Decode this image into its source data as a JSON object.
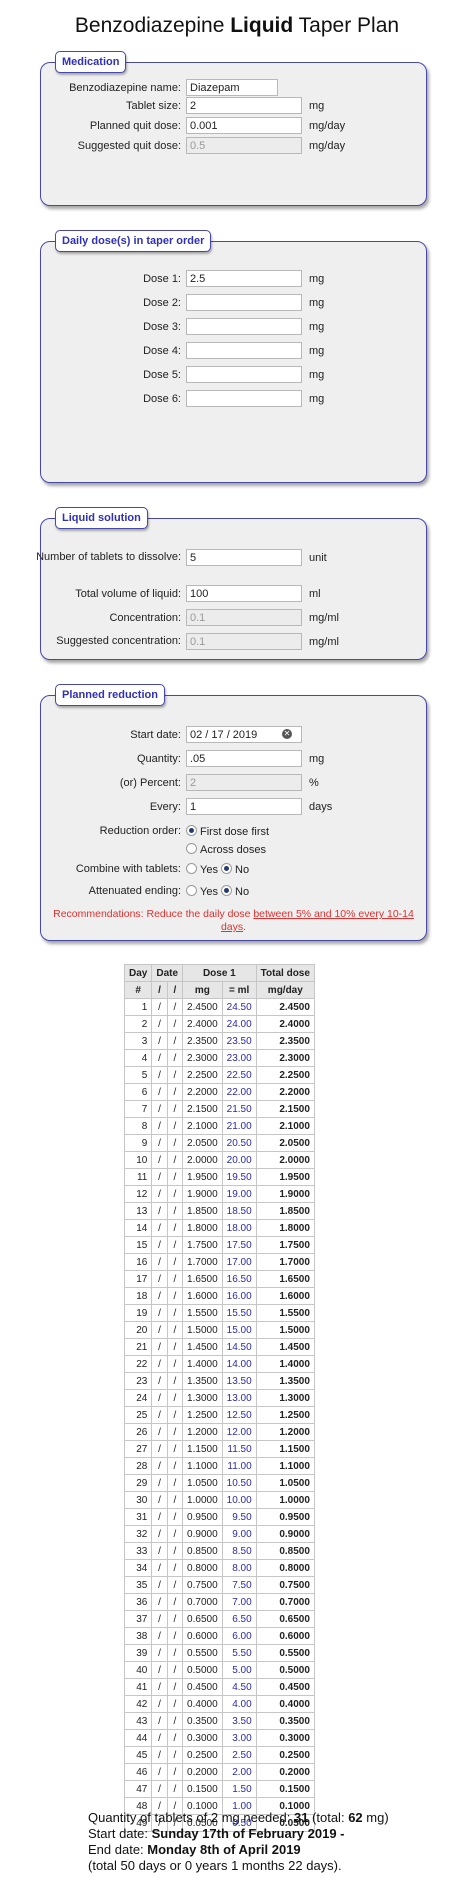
{
  "title": {
    "pre": "Benzodiazepine ",
    "bold": "Liquid",
    "post": " Taper Plan"
  },
  "medication": {
    "legend": "Medication",
    "name_label": "Benzodiazepine name:",
    "name_value": "Diazepam",
    "tablet_label": "Tablet size:",
    "tablet_value": "2",
    "tablet_unit": "mg",
    "quit_label": "Planned quit dose:",
    "quit_value": "0.001",
    "quit_unit": "mg/day",
    "suggested_label": "Suggested quit dose:",
    "suggested_value": "0.5",
    "suggested_unit": "mg/day"
  },
  "daily": {
    "legend": "Daily dose(s) in taper order",
    "doses": [
      {
        "label": "Dose 1:",
        "value": "2.5",
        "unit": "mg"
      },
      {
        "label": "Dose 2:",
        "value": "",
        "unit": "mg"
      },
      {
        "label": "Dose 3:",
        "value": "",
        "unit": "mg"
      },
      {
        "label": "Dose 4:",
        "value": "",
        "unit": "mg"
      },
      {
        "label": "Dose 5:",
        "value": "",
        "unit": "mg"
      },
      {
        "label": "Dose 6:",
        "value": "",
        "unit": "mg"
      }
    ]
  },
  "liquid": {
    "legend": "Liquid solution",
    "tablets_label": "Number of tablets to dissolve:",
    "tablets_value": "5",
    "tablets_unit": "unit",
    "volume_label": "Total volume of liquid:",
    "volume_value": "100",
    "volume_unit": "ml",
    "conc_label": "Concentration:",
    "conc_value": "0.1",
    "conc_unit": "mg/ml",
    "sugg_label": "Suggested concentration:",
    "sugg_value": "0.1",
    "sugg_unit": "mg/ml"
  },
  "reduction": {
    "legend": "Planned reduction",
    "start_label": "Start date:",
    "start_value": "02 / 17 / 2019",
    "clear_glyph": "✕",
    "qty_label": "Quantity:",
    "qty_value": ".05",
    "qty_unit": "mg",
    "pct_label": "(or) Percent:",
    "pct_value": "2",
    "pct_unit": "%",
    "every_label": "Every:",
    "every_value": "1",
    "every_unit": "days",
    "order_label": "Reduction order:",
    "order_opt1": "First dose first",
    "order_opt2": "Across doses",
    "combine_label": "Combine with tablets:",
    "yes": "Yes",
    "no": "No",
    "atten_label": "Attenuated ending:",
    "rec_pre": "Recommendations: Reduce the daily dose ",
    "rec_link": "between 5% and 10% every 10-14 days",
    "rec_post": "."
  },
  "table": {
    "h_day": "Day",
    "h_date": "Date",
    "h_dose1": "Dose 1",
    "h_total": "Total dose",
    "h_num": "#",
    "h_slash1": "/",
    "h_slash2": "/",
    "h_mg": "mg",
    "h_ml": "= ml",
    "h_mgday": "mg/day",
    "rows": [
      [
        "1",
        "2.4500",
        "24.50",
        "2.4500"
      ],
      [
        "2",
        "2.4000",
        "24.00",
        "2.4000"
      ],
      [
        "3",
        "2.3500",
        "23.50",
        "2.3500"
      ],
      [
        "4",
        "2.3000",
        "23.00",
        "2.3000"
      ],
      [
        "5",
        "2.2500",
        "22.50",
        "2.2500"
      ],
      [
        "6",
        "2.2000",
        "22.00",
        "2.2000"
      ],
      [
        "7",
        "2.1500",
        "21.50",
        "2.1500"
      ],
      [
        "8",
        "2.1000",
        "21.00",
        "2.1000"
      ],
      [
        "9",
        "2.0500",
        "20.50",
        "2.0500"
      ],
      [
        "10",
        "2.0000",
        "20.00",
        "2.0000"
      ],
      [
        "11",
        "1.9500",
        "19.50",
        "1.9500"
      ],
      [
        "12",
        "1.9000",
        "19.00",
        "1.9000"
      ],
      [
        "13",
        "1.8500",
        "18.50",
        "1.8500"
      ],
      [
        "14",
        "1.8000",
        "18.00",
        "1.8000"
      ],
      [
        "15",
        "1.7500",
        "17.50",
        "1.7500"
      ],
      [
        "16",
        "1.7000",
        "17.00",
        "1.7000"
      ],
      [
        "17",
        "1.6500",
        "16.50",
        "1.6500"
      ],
      [
        "18",
        "1.6000",
        "16.00",
        "1.6000"
      ],
      [
        "19",
        "1.5500",
        "15.50",
        "1.5500"
      ],
      [
        "20",
        "1.5000",
        "15.00",
        "1.5000"
      ],
      [
        "21",
        "1.4500",
        "14.50",
        "1.4500"
      ],
      [
        "22",
        "1.4000",
        "14.00",
        "1.4000"
      ],
      [
        "23",
        "1.3500",
        "13.50",
        "1.3500"
      ],
      [
        "24",
        "1.3000",
        "13.00",
        "1.3000"
      ],
      [
        "25",
        "1.2500",
        "12.50",
        "1.2500"
      ],
      [
        "26",
        "1.2000",
        "12.00",
        "1.2000"
      ],
      [
        "27",
        "1.1500",
        "11.50",
        "1.1500"
      ],
      [
        "28",
        "1.1000",
        "11.00",
        "1.1000"
      ],
      [
        "29",
        "1.0500",
        "10.50",
        "1.0500"
      ],
      [
        "30",
        "1.0000",
        "10.00",
        "1.0000"
      ],
      [
        "31",
        "0.9500",
        "9.50",
        "0.9500"
      ],
      [
        "32",
        "0.9000",
        "9.00",
        "0.9000"
      ],
      [
        "33",
        "0.8500",
        "8.50",
        "0.8500"
      ],
      [
        "34",
        "0.8000",
        "8.00",
        "0.8000"
      ],
      [
        "35",
        "0.7500",
        "7.50",
        "0.7500"
      ],
      [
        "36",
        "0.7000",
        "7.00",
        "0.7000"
      ],
      [
        "37",
        "0.6500",
        "6.50",
        "0.6500"
      ],
      [
        "38",
        "0.6000",
        "6.00",
        "0.6000"
      ],
      [
        "39",
        "0.5500",
        "5.50",
        "0.5500"
      ],
      [
        "40",
        "0.5000",
        "5.00",
        "0.5000"
      ],
      [
        "41",
        "0.4500",
        "4.50",
        "0.4500"
      ],
      [
        "42",
        "0.4000",
        "4.00",
        "0.4000"
      ],
      [
        "43",
        "0.3500",
        "3.50",
        "0.3500"
      ],
      [
        "44",
        "0.3000",
        "3.00",
        "0.3000"
      ],
      [
        "45",
        "0.2500",
        "2.50",
        "0.2500"
      ],
      [
        "46",
        "0.2000",
        "2.00",
        "0.2000"
      ],
      [
        "47",
        "0.1500",
        "1.50",
        "0.1500"
      ],
      [
        "48",
        "0.1000",
        "1.00",
        "0.1000"
      ],
      [
        "49",
        "0.0500",
        "0.50",
        "0.0500"
      ]
    ]
  },
  "summary": {
    "qty_pre": "Quantity of tablets of 2 mg needed: ",
    "qty_count": "31",
    "qty_mid": " (total: ",
    "qty_total": "62",
    "qty_post": " mg)",
    "start_pre": "Start date: ",
    "start_date": "Sunday 17th of February 2019",
    "start_post": " -",
    "end_pre": "End date: ",
    "end_date": "Monday 8th of April 2019",
    "duration": "(total 50 days or 0 years 1 months 22 days)."
  }
}
